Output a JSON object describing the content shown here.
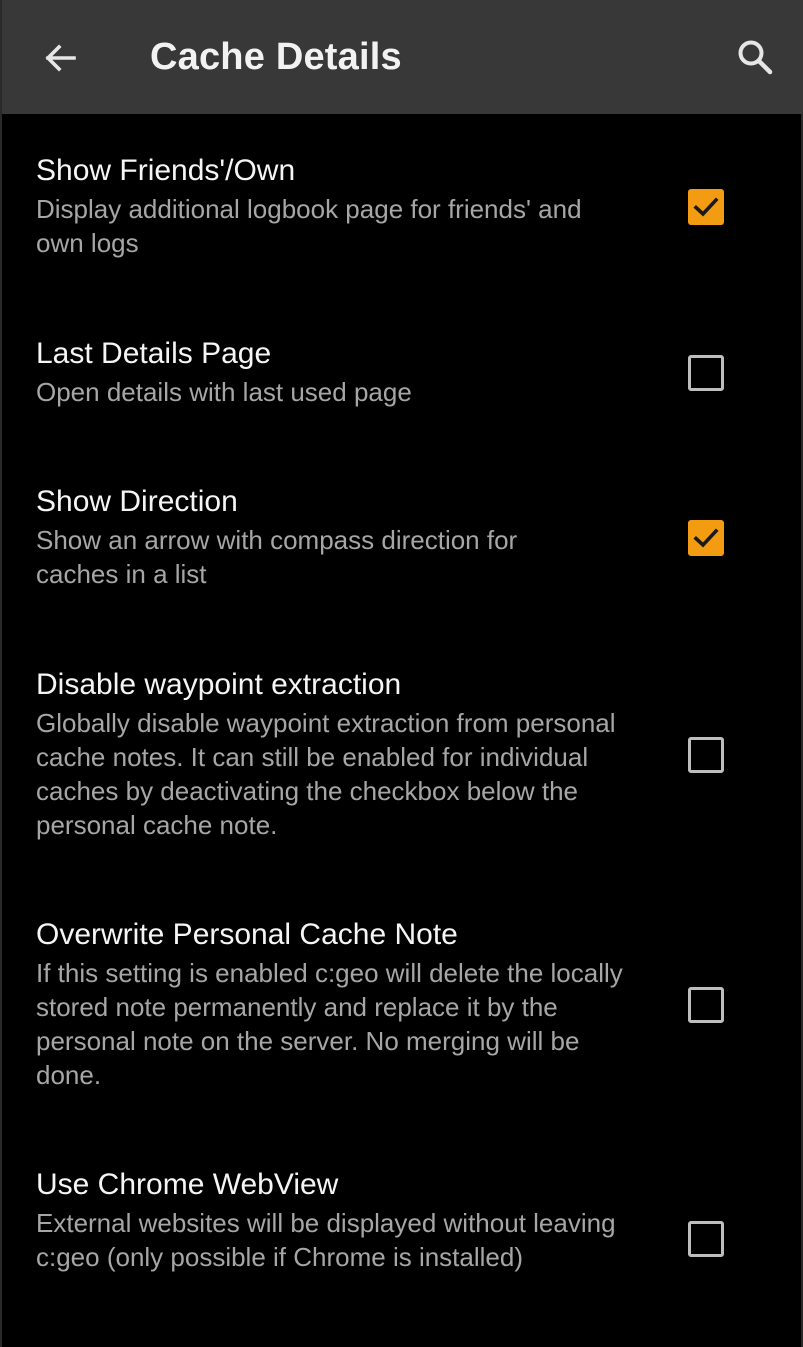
{
  "toolbar": {
    "title": "Cache Details",
    "back_icon": "arrow-left-icon",
    "search_icon": "search-icon",
    "background": "#383838"
  },
  "accent_color": "#f39c12",
  "preferences": [
    {
      "title": "Show Friends'/Own",
      "summary": "Display additional logbook page for friends' and own logs",
      "checked": true
    },
    {
      "title": "Last Details Page",
      "summary": "Open details with last used page",
      "checked": false
    },
    {
      "title": "Show Direction",
      "summary": "Show an arrow with compass direction for caches in a list",
      "checked": true
    },
    {
      "title": "Disable waypoint extraction",
      "summary": "Globally disable waypoint extraction from personal cache notes. It can still be enabled for individual caches by deactivating the checkbox below the personal cache note.",
      "checked": false
    },
    {
      "title": "Overwrite Personal Cache Note",
      "summary": "If this setting is enabled c:geo will delete the locally stored note permanently and replace it by the personal note on the server. No merging will be done.",
      "checked": false
    },
    {
      "title": "Use Chrome WebView",
      "summary": "External websites will be displayed without leaving c:geo (only possible if Chrome is installed)",
      "checked": false
    }
  ]
}
